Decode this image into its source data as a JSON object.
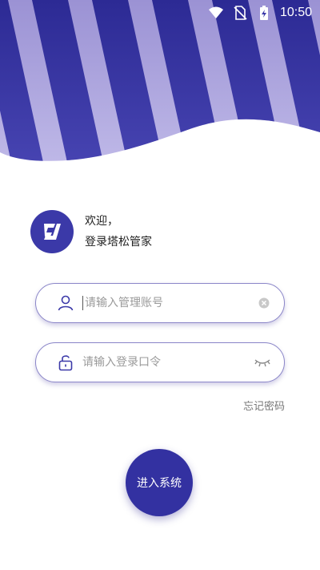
{
  "status_bar": {
    "time": "10:50",
    "icons": [
      "wifi-icon",
      "no-sim-icon",
      "battery-charging-icon"
    ]
  },
  "greeting": {
    "line1": "欢迎，",
    "line2": "登录塔松管家"
  },
  "logo": {
    "icon": "brand-logo-icon",
    "color": "#3b39a8"
  },
  "account": {
    "placeholder": "请输入管理账号",
    "value": "",
    "lead_icon": "user-icon",
    "trail_icon": "clear-icon"
  },
  "password": {
    "placeholder": "请输入登录口令",
    "value": "",
    "lead_icon": "lock-icon",
    "trail_icon": "eye-closed-icon"
  },
  "forgot_password": "忘记密码",
  "login_button": "进入系统",
  "colors": {
    "accent": "#3331a1",
    "stripe_light": "#a79fd9",
    "field_border": "#8b86c8"
  }
}
